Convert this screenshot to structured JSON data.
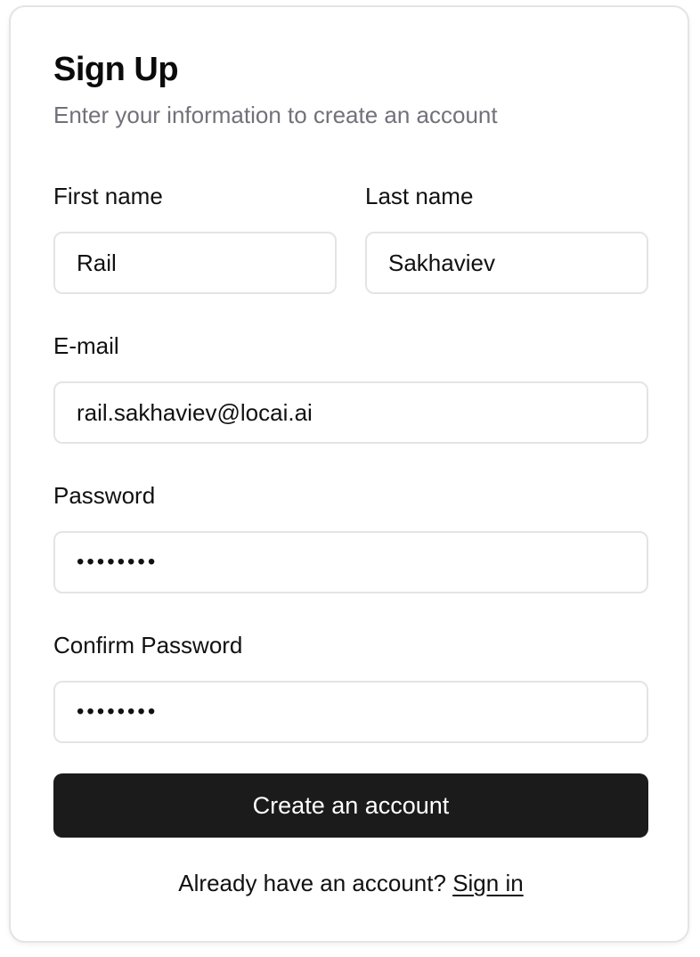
{
  "form": {
    "title": "Sign Up",
    "subtitle": "Enter your information to create an account",
    "first_name": {
      "label": "First name",
      "value": "Rail"
    },
    "last_name": {
      "label": "Last name",
      "value": "Sakhaviev"
    },
    "email": {
      "label": "E-mail",
      "value": "rail.sakhaviev@locai.ai"
    },
    "password": {
      "label": "Password",
      "value": "••••••••"
    },
    "confirm_password": {
      "label": "Confirm Password",
      "value": "••••••••"
    },
    "submit_label": "Create an account",
    "footer_text": "Already have an account?",
    "sign_in_link": "Sign in"
  }
}
